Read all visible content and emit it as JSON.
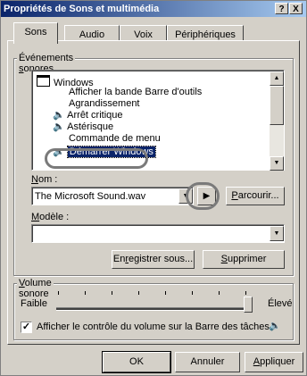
{
  "window": {
    "title": "Propriétés de Sons et multimédia",
    "help_btn": "?",
    "close_btn": "X"
  },
  "tabs": [
    {
      "label": "Sons",
      "active": true
    },
    {
      "label": "Audio",
      "active": false
    },
    {
      "label": "Voix",
      "active": false
    },
    {
      "label": "Périphériques",
      "active": false
    }
  ],
  "events_group": {
    "label_prefix": "Événements ",
    "label_ul": "s",
    "label_rest": "onores",
    "items": [
      {
        "label": "Windows",
        "kind": "folder"
      },
      {
        "label": "Afficher la bande Barre d'outils",
        "kind": "none"
      },
      {
        "label": "Agrandissement",
        "kind": "none"
      },
      {
        "label": "Arrêt critique",
        "kind": "sound"
      },
      {
        "label": "Astérisque",
        "kind": "sound"
      },
      {
        "label": "Commande de menu",
        "kind": "none"
      },
      {
        "label": "Démarrer Windows",
        "kind": "sound",
        "selected": true
      }
    ]
  },
  "name": {
    "label_ul": "N",
    "label_rest": "om :",
    "value": "The Microsoft Sound.wav",
    "browse_ul": "P",
    "browse_rest": "arcourir..."
  },
  "scheme": {
    "label_ul": "M",
    "label_rest": "odèle :",
    "value": "",
    "save_pre": "En",
    "save_ul": "r",
    "save_post": "egistrer sous...",
    "delete_ul": "S",
    "delete_rest": "upprimer"
  },
  "volume": {
    "label_ul": "V",
    "label_rest": "olume sonore",
    "low": "Faible",
    "high": "Élevé",
    "level": 1.0,
    "taskbar_label": "Afficher le contrôle du volume sur la Barre des tâches",
    "taskbar_checked": true
  },
  "footer": {
    "ok": "OK",
    "cancel": "Annuler",
    "apply_ul": "A",
    "apply_rest": "ppliquer"
  },
  "icons": {
    "play": "play-icon",
    "speaker": "speaker-icon",
    "folder": "windows-folder-icon"
  }
}
